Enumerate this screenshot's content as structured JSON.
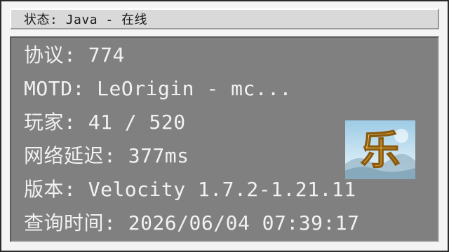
{
  "title": {
    "label": "状态",
    "separator": ": ",
    "edition": "Java",
    "dash": " - ",
    "status": "在线"
  },
  "rows": [
    {
      "label": "协议",
      "sep": ": ",
      "value": "774"
    },
    {
      "label": "MOTD",
      "sep": ": ",
      "value": "LeOrigin - mc..."
    },
    {
      "label": "玩家",
      "sep": ": ",
      "value": "41 / 520"
    },
    {
      "label": "网络延迟",
      "sep": ": ",
      "value": "377ms"
    },
    {
      "label": "版本",
      "sep": ": ",
      "value": "Velocity 1.7.2-1.21.11"
    },
    {
      "label": "查询时间",
      "sep": ": ",
      "value": "2026/06/04 07:39:17"
    }
  ],
  "icon": {
    "name": "server-icon",
    "glyph": "乐"
  },
  "colors": {
    "panel": "#808080",
    "text": "#f2f2f2",
    "titlebar": "#d9d9d9"
  }
}
